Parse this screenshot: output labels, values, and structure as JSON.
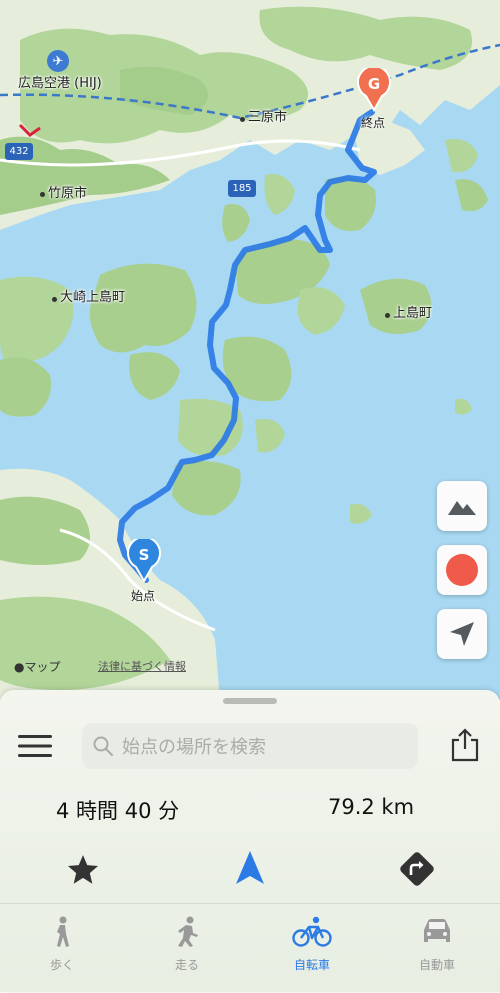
{
  "map": {
    "places": [
      {
        "name": "広島空港 (HIJ)"
      },
      {
        "name": "三原市"
      },
      {
        "name": "竹原市"
      },
      {
        "name": "大崎上島町"
      },
      {
        "name": "上島町"
      }
    ],
    "roads": [
      {
        "number": "432"
      },
      {
        "number": "185"
      }
    ],
    "start": {
      "letter": "S",
      "label": "始点"
    },
    "goal": {
      "letter": "G",
      "label": "終点"
    },
    "attribution": {
      "brand": "マップ",
      "legal": "法律に基づく情報"
    },
    "colors": {
      "route": "#2c7be5",
      "water": "#a9d9f2",
      "land": "#e9f0dc",
      "forest": "#a9cf8e",
      "goal_marker": "#f0704f",
      "start_marker": "#2e86de"
    }
  },
  "map_buttons": {
    "terrain_icon": "mountain-icon",
    "record_icon": "record-icon",
    "locate_icon": "location-arrow-icon"
  },
  "sheet": {
    "search_placeholder": "始点の場所を検索",
    "duration": "4 時間 40 分",
    "distance": "79.2 km"
  },
  "tabs": [
    {
      "label": "歩く",
      "active": false
    },
    {
      "label": "走る",
      "active": false
    },
    {
      "label": "自転車",
      "active": true
    },
    {
      "label": "自動車",
      "active": false
    }
  ]
}
